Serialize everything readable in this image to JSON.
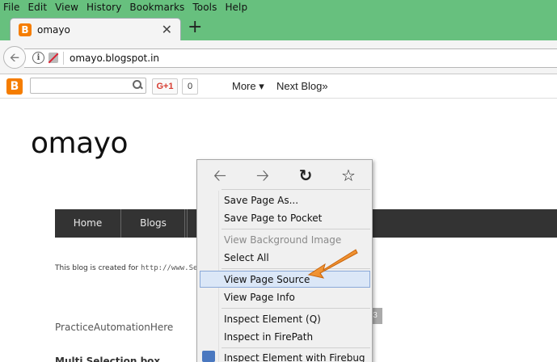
{
  "menubar": {
    "items": [
      {
        "label": "File"
      },
      {
        "label": "Edit"
      },
      {
        "label": "View"
      },
      {
        "label": "History"
      },
      {
        "label": "Bookmarks"
      },
      {
        "label": "Tools"
      },
      {
        "label": "Help"
      }
    ]
  },
  "tab": {
    "title": "omayo",
    "favicon": "B",
    "close": "✕",
    "new_tab": "+"
  },
  "navbar": {
    "url": "omayo.blogspot.in"
  },
  "blogger_bar": {
    "logo": "B",
    "search_placeholder": "",
    "gplus_label": "G+1",
    "gplus_count": "0",
    "more_label": "More ▾",
    "next_blog_label": "Next Blog»"
  },
  "page": {
    "title": "omayo",
    "tabs": [
      {
        "label": "Home"
      },
      {
        "label": "Blogs"
      }
    ],
    "intro_text": "This blog is created for",
    "intro_link": "http://www.Se",
    "practice_heading": "PracticeAutomationHere",
    "multi_heading": "Multi Selection box",
    "badge": "3"
  },
  "context_menu": {
    "nav_icons": [
      "back-arrow-icon",
      "forward-arrow-icon",
      "reload-icon",
      "bookmark-star-icon"
    ],
    "items": [
      {
        "label": "Save Page As...",
        "disabled": false
      },
      {
        "label": "Save Page to Pocket",
        "disabled": false
      },
      {
        "label": "View Background Image",
        "disabled": true
      },
      {
        "label": "Select All",
        "disabled": false
      },
      {
        "label": "View Page Source",
        "disabled": false,
        "highlighted": true
      },
      {
        "label": "View Page Info",
        "disabled": false
      },
      {
        "label": "Inspect Element (Q)",
        "disabled": false
      },
      {
        "label": "Inspect in FirePath",
        "disabled": false
      },
      {
        "label": "Inspect Element with Firebug",
        "disabled": false
      }
    ]
  },
  "colors": {
    "chrome_green": "#67c07e",
    "blogger_orange": "#f57d00",
    "annotation_arrow": "#f28a1d",
    "highlight": "#dbe7f7"
  }
}
